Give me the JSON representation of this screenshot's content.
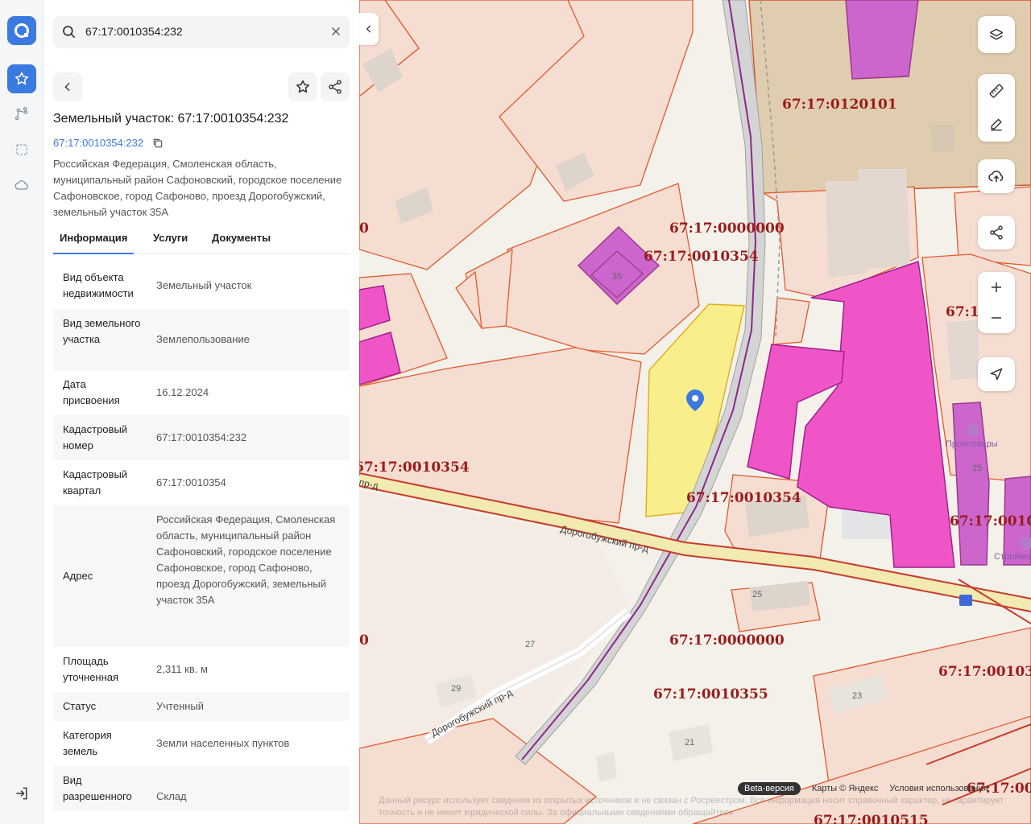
{
  "search": {
    "value": "67:17:0010354:232"
  },
  "panel": {
    "title": "Земельный участок: 67:17:0010354:232",
    "cad_link": "67:17:0010354:232",
    "address": "Российская Федерация, Смоленская область, муниципальный район Сафоновский, городское поселение Сафоновское, город Сафоново, проезд Дорогобужский, земельный участок 35А",
    "tabs": [
      "Информация",
      "Услуги",
      "Документы"
    ],
    "rows": [
      {
        "label": "Вид объекта недвижимости",
        "value": "Земельный участок"
      },
      {
        "label": "Вид земельного участка",
        "value": "Землепользование"
      },
      {
        "label": "Дата присвоения",
        "value": "16.12.2024"
      },
      {
        "label": "Кадастровый номер",
        "value": "67:17:0010354:232"
      },
      {
        "label": "Кадастровый квартал",
        "value": "67:17:0010354"
      },
      {
        "label": "Адрес",
        "value": "Российская Федерация, Смоленская область, муниципальный район Сафоновский, городское поселение Сафоновское, город Сафоново, проезд Дорогобужский, земельный участок 35А"
      },
      {
        "label": "Площадь уточненная",
        "value": "2,311 кв. м"
      },
      {
        "label": "Статус",
        "value": "Учтенный"
      },
      {
        "label": "Категория земель",
        "value": "Земли населенных пунктов"
      },
      {
        "label": "Вид разрешенного",
        "value": "Склад"
      }
    ]
  },
  "map": {
    "cad_labels": [
      "67:17:0120101",
      "67:17:0000000",
      "67:17:0010354",
      "67:17:0010354",
      "67:17:0010354",
      "67:17:0000000",
      "67:17:0010355",
      "67:17:0010515",
      "67:17:0010",
      "67:17:001035",
      "67:1",
      "0",
      "0",
      "67:17:001"
    ],
    "numbers": [
      "35",
      "25",
      "25",
      "27",
      "29",
      "21",
      "23"
    ],
    "streets": [
      "Дорогобужский пр-д",
      "Дорогобужский пр-д",
      "пр-д"
    ],
    "pois": [
      "Промтовары",
      "Строймат"
    ],
    "footer": {
      "beta": "Beta-версия",
      "maps": "Карты © Яндекс",
      "terms": "Условия использования"
    },
    "disclaimer": "Данный ресурс использует сведения из открытых источников и не связан с Росреестром. Вся информация носит справочный характер, не гарантирует точность и не имеет юридической силы. За официальными сведениями обращайтесь"
  },
  "colors": {
    "accent": "#3b7ae0",
    "parcel_fill": "#f7e0d8",
    "parcel_stroke": "#e0552c",
    "selected_fill": "#f8ef8c",
    "building_magenta": "#f055c8",
    "purple_building": "#cc66cc",
    "quarter_label": "#9b1b1b"
  }
}
